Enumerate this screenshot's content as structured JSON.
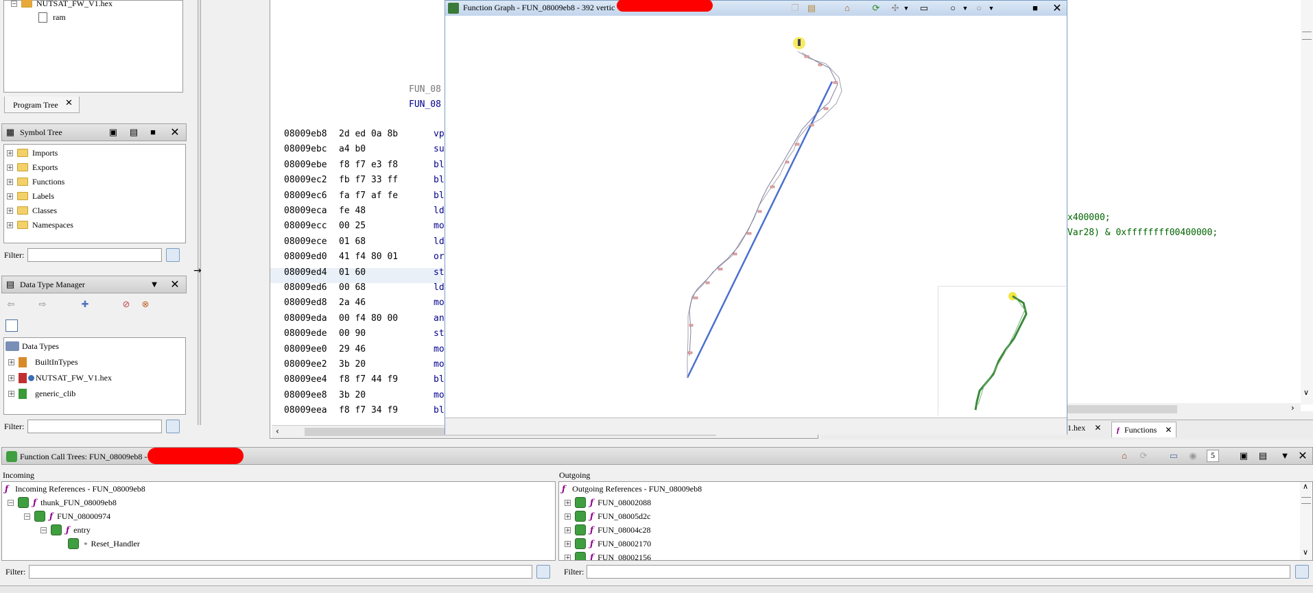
{
  "program_tree": {
    "root_label": "NUTSAT_FW_V1.hex",
    "child_label": "ram",
    "tab_label": "Program Tree"
  },
  "symbol_tree": {
    "title": "Symbol Tree",
    "items": [
      "Imports",
      "Exports",
      "Functions",
      "Labels",
      "Classes",
      "Namespaces"
    ],
    "filter_label": "Filter:"
  },
  "data_type_manager": {
    "title": "Data Type Manager",
    "root": "Data Types",
    "items": [
      "BuiltInTypes",
      "NUTSAT_FW_V1.hex",
      "generic_clib"
    ],
    "filter_label": "Filter:"
  },
  "listing": {
    "labels": [
      "FUN_08",
      "FUN_08"
    ],
    "rows": [
      {
        "addr": "08009eb8",
        "bytes": "2d ed 0a 8b",
        "mnem": "vp"
      },
      {
        "addr": "08009ebc",
        "bytes": "a4 b0",
        "mnem": "su"
      },
      {
        "addr": "08009ebe",
        "bytes": "f8 f7 e3 f8",
        "mnem": "bl"
      },
      {
        "addr": "08009ec2",
        "bytes": "fb f7 33 ff",
        "mnem": "bl"
      },
      {
        "addr": "08009ec6",
        "bytes": "fa f7 af fe",
        "mnem": "bl"
      },
      {
        "addr": "08009eca",
        "bytes": "fe 48",
        "mnem": "ld"
      },
      {
        "addr": "08009ecc",
        "bytes": "00 25",
        "mnem": "mo"
      },
      {
        "addr": "08009ece",
        "bytes": "01 68",
        "mnem": "ld"
      },
      {
        "addr": "08009ed0",
        "bytes": "41 f4 80 01",
        "mnem": "or"
      },
      {
        "addr": "08009ed4",
        "bytes": "01 60",
        "mnem": "st"
      },
      {
        "addr": "08009ed6",
        "bytes": "00 68",
        "mnem": "ld"
      },
      {
        "addr": "08009ed8",
        "bytes": "2a 46",
        "mnem": "mo"
      },
      {
        "addr": "08009eda",
        "bytes": "00 f4 80 00",
        "mnem": "an"
      },
      {
        "addr": "08009ede",
        "bytes": "00 90",
        "mnem": "st"
      },
      {
        "addr": "08009ee0",
        "bytes": "29 46",
        "mnem": "mo"
      },
      {
        "addr": "08009ee2",
        "bytes": "3b 20",
        "mnem": "mo"
      },
      {
        "addr": "08009ee4",
        "bytes": "f8 f7 44 f9",
        "mnem": "bl"
      },
      {
        "addr": "08009ee8",
        "bytes": "3b 20",
        "mnem": "mo"
      },
      {
        "addr": "08009eea",
        "bytes": "f8 f7 34 f9",
        "mnem": "bl"
      }
    ]
  },
  "decompiler": {
    "line1": "x400000;",
    "line2": "Var28) & 0xffffffff00400000;"
  },
  "function_graph": {
    "title": "Function Graph - FUN_08009eb8 - 392 vertic"
  },
  "tabs_right": {
    "hex_tab": "1.hex",
    "functions_tab": "Functions"
  },
  "call_trees": {
    "title": "Function Call Trees: FUN_08009eb8 -",
    "depth": "5",
    "incoming_label": "Incoming",
    "outgoing_label": "Outgoing",
    "incoming_root": "Incoming References - FUN_08009eb8",
    "incoming_items": [
      "thunk_FUN_08009eb8",
      "FUN_08000974",
      "entry",
      "Reset_Handler"
    ],
    "outgoing_root": "Outgoing References - FUN_08009eb8",
    "outgoing_items": [
      "FUN_08002088",
      "FUN_08005d2c",
      "FUN_08004c28",
      "FUN_08002170",
      "FUN_08002156"
    ],
    "filter_label": "Filter:"
  },
  "colors": {
    "graph_edge": "#4a6fd0",
    "graph_node_highlight": "#f3e63d",
    "satellite_green": "#3a8a3a",
    "redaction": "#ff0000"
  }
}
